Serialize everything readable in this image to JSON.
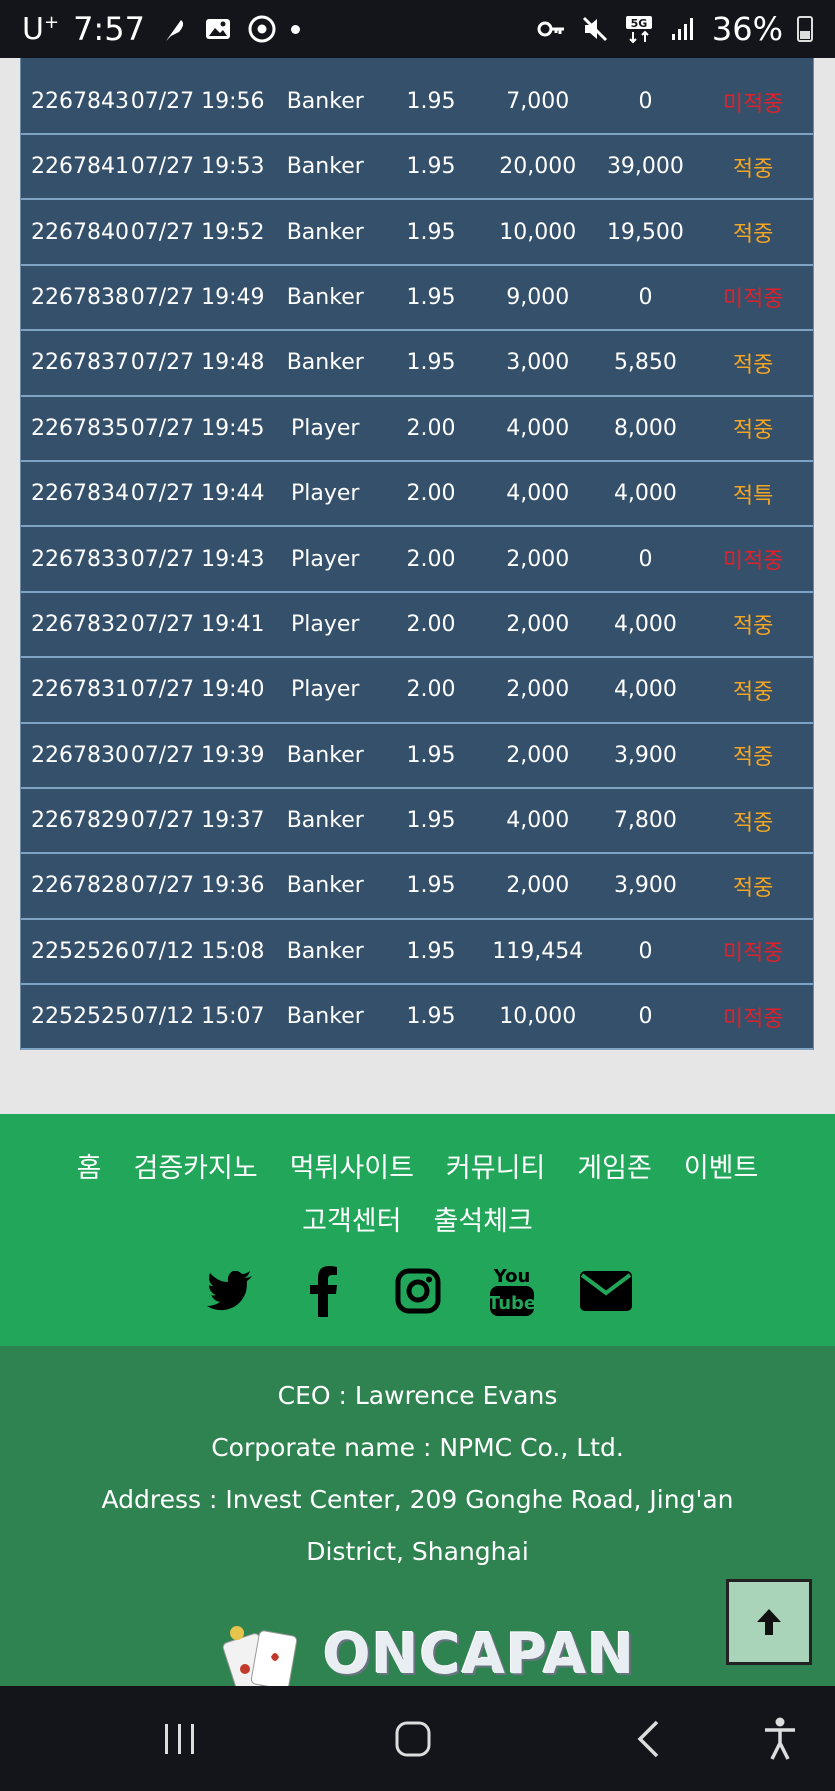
{
  "status_bar": {
    "carrier": "U",
    "carrier_sup": "+",
    "time": "7:57",
    "battery": "36%",
    "network": "5G"
  },
  "table": {
    "rows": [
      {
        "id": "2267843",
        "datetime": "07/27 19:56",
        "pick": "Banker",
        "odds": "1.95",
        "bet": "7,000",
        "win": "0",
        "result": "미적중",
        "status": "miss"
      },
      {
        "id": "2267841",
        "datetime": "07/27 19:53",
        "pick": "Banker",
        "odds": "1.95",
        "bet": "20,000",
        "win": "39,000",
        "result": "적중",
        "status": "hit"
      },
      {
        "id": "2267840",
        "datetime": "07/27 19:52",
        "pick": "Banker",
        "odds": "1.95",
        "bet": "10,000",
        "win": "19,500",
        "result": "적중",
        "status": "hit"
      },
      {
        "id": "2267838",
        "datetime": "07/27 19:49",
        "pick": "Banker",
        "odds": "1.95",
        "bet": "9,000",
        "win": "0",
        "result": "미적중",
        "status": "miss"
      },
      {
        "id": "2267837",
        "datetime": "07/27 19:48",
        "pick": "Banker",
        "odds": "1.95",
        "bet": "3,000",
        "win": "5,850",
        "result": "적중",
        "status": "hit"
      },
      {
        "id": "2267835",
        "datetime": "07/27 19:45",
        "pick": "Player",
        "odds": "2.00",
        "bet": "4,000",
        "win": "8,000",
        "result": "적중",
        "status": "hit"
      },
      {
        "id": "2267834",
        "datetime": "07/27 19:44",
        "pick": "Player",
        "odds": "2.00",
        "bet": "4,000",
        "win": "4,000",
        "result": "적특",
        "status": "hit"
      },
      {
        "id": "2267833",
        "datetime": "07/27 19:43",
        "pick": "Player",
        "odds": "2.00",
        "bet": "2,000",
        "win": "0",
        "result": "미적중",
        "status": "miss"
      },
      {
        "id": "2267832",
        "datetime": "07/27 19:41",
        "pick": "Player",
        "odds": "2.00",
        "bet": "2,000",
        "win": "4,000",
        "result": "적중",
        "status": "hit"
      },
      {
        "id": "2267831",
        "datetime": "07/27 19:40",
        "pick": "Player",
        "odds": "2.00",
        "bet": "2,000",
        "win": "4,000",
        "result": "적중",
        "status": "hit"
      },
      {
        "id": "2267830",
        "datetime": "07/27 19:39",
        "pick": "Banker",
        "odds": "1.95",
        "bet": "2,000",
        "win": "3,900",
        "result": "적중",
        "status": "hit"
      },
      {
        "id": "2267829",
        "datetime": "07/27 19:37",
        "pick": "Banker",
        "odds": "1.95",
        "bet": "4,000",
        "win": "7,800",
        "result": "적중",
        "status": "hit"
      },
      {
        "id": "2267828",
        "datetime": "07/27 19:36",
        "pick": "Banker",
        "odds": "1.95",
        "bet": "2,000",
        "win": "3,900",
        "result": "적중",
        "status": "hit"
      },
      {
        "id": "2252526",
        "datetime": "07/12 15:08",
        "pick": "Banker",
        "odds": "1.95",
        "bet": "119,454",
        "win": "0",
        "result": "미적중",
        "status": "miss"
      },
      {
        "id": "2252525",
        "datetime": "07/12 15:07",
        "pick": "Banker",
        "odds": "1.95",
        "bet": "10,000",
        "win": "0",
        "result": "미적중",
        "status": "miss"
      }
    ]
  },
  "footer": {
    "menu": [
      {
        "label": "홈"
      },
      {
        "label": "검증카지노"
      },
      {
        "label": "먹튀사이트"
      },
      {
        "label": "커뮤니티"
      },
      {
        "label": "게임존"
      },
      {
        "label": "이벤트"
      },
      {
        "label": "고객센터"
      },
      {
        "label": "출석체크"
      }
    ],
    "socials": [
      "twitter-icon",
      "facebook-icon",
      "instagram-icon",
      "youtube-icon",
      "mail-icon"
    ],
    "ceo": "CEO : Lawrence Evans",
    "corporate": "Corporate name : NPMC Co., Ltd.",
    "address": "Address : Invest Center, 209 Gonghe Road, Jing'an District, Shanghai",
    "logo_text": "ONCAPAN"
  },
  "colors": {
    "hit": "#f3a524",
    "miss": "#e0202a",
    "table_bg": "#34506b",
    "footer_green": "#22a75a",
    "company_green": "#2e8350"
  }
}
